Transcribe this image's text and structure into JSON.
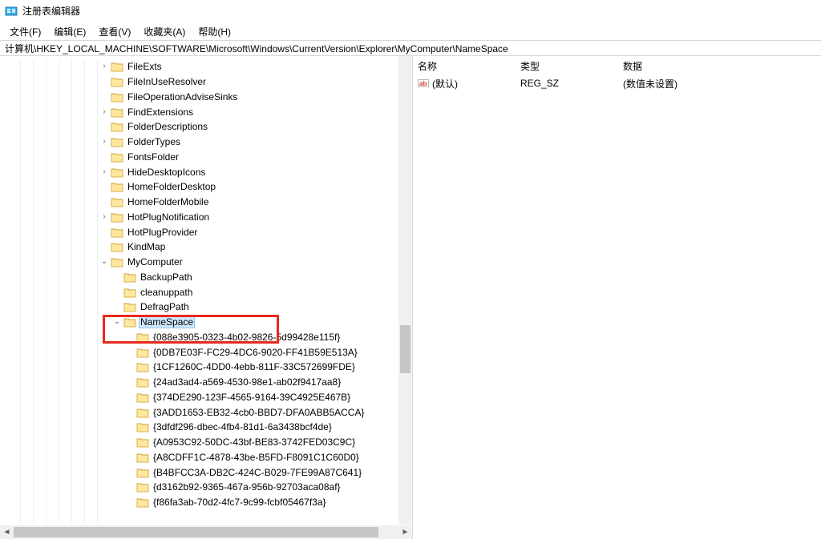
{
  "window": {
    "title": "注册表编辑器"
  },
  "menu": {
    "file": "文件(F)",
    "edit": "编辑(E)",
    "view": "查看(V)",
    "favorites": "收藏夹(A)",
    "help": "帮助(H)"
  },
  "address": "计算机\\HKEY_LOCAL_MACHINE\\SOFTWARE\\Microsoft\\Windows\\CurrentVersion\\Explorer\\MyComputer\\NameSpace",
  "tree": [
    {
      "indent": 7,
      "exp": "closed",
      "label": "FileExts"
    },
    {
      "indent": 7,
      "exp": "none",
      "label": "FileInUseResolver"
    },
    {
      "indent": 7,
      "exp": "none",
      "label": "FileOperationAdviseSinks"
    },
    {
      "indent": 7,
      "exp": "closed",
      "label": "FindExtensions"
    },
    {
      "indent": 7,
      "exp": "none",
      "label": "FolderDescriptions"
    },
    {
      "indent": 7,
      "exp": "closed",
      "label": "FolderTypes"
    },
    {
      "indent": 7,
      "exp": "none",
      "label": "FontsFolder"
    },
    {
      "indent": 7,
      "exp": "closed",
      "label": "HideDesktopIcons"
    },
    {
      "indent": 7,
      "exp": "none",
      "label": "HomeFolderDesktop"
    },
    {
      "indent": 7,
      "exp": "none",
      "label": "HomeFolderMobile"
    },
    {
      "indent": 7,
      "exp": "closed",
      "label": "HotPlugNotification"
    },
    {
      "indent": 7,
      "exp": "none",
      "label": "HotPlugProvider"
    },
    {
      "indent": 7,
      "exp": "none",
      "label": "KindMap"
    },
    {
      "indent": 7,
      "exp": "open",
      "label": "MyComputer"
    },
    {
      "indent": 8,
      "exp": "none",
      "label": "BackupPath"
    },
    {
      "indent": 8,
      "exp": "none",
      "label": "cleanuppath"
    },
    {
      "indent": 8,
      "exp": "none",
      "label": "DefragPath"
    },
    {
      "indent": 8,
      "exp": "open",
      "label": "NameSpace",
      "selected": true
    },
    {
      "indent": 9,
      "exp": "none",
      "label": "{088e3905-0323-4b02-9826-5d99428e115f}"
    },
    {
      "indent": 9,
      "exp": "none",
      "label": "{0DB7E03F-FC29-4DC6-9020-FF41B59E513A}"
    },
    {
      "indent": 9,
      "exp": "none",
      "label": "{1CF1260C-4DD0-4ebb-811F-33C572699FDE}"
    },
    {
      "indent": 9,
      "exp": "none",
      "label": "{24ad3ad4-a569-4530-98e1-ab02f9417aa8}"
    },
    {
      "indent": 9,
      "exp": "none",
      "label": "{374DE290-123F-4565-9164-39C4925E467B}"
    },
    {
      "indent": 9,
      "exp": "none",
      "label": "{3ADD1653-EB32-4cb0-BBD7-DFA0ABB5ACCA}"
    },
    {
      "indent": 9,
      "exp": "none",
      "label": "{3dfdf296-dbec-4fb4-81d1-6a3438bcf4de}"
    },
    {
      "indent": 9,
      "exp": "none",
      "label": "{A0953C92-50DC-43bf-BE83-3742FED03C9C}"
    },
    {
      "indent": 9,
      "exp": "none",
      "label": "{A8CDFF1C-4878-43be-B5FD-F8091C1C60D0}"
    },
    {
      "indent": 9,
      "exp": "none",
      "label": "{B4BFCC3A-DB2C-424C-B029-7FE99A87C641}"
    },
    {
      "indent": 9,
      "exp": "none",
      "label": "{d3162b92-9365-467a-956b-92703aca08af}"
    },
    {
      "indent": 9,
      "exp": "none",
      "label": "{f86fa3ab-70d2-4fc7-9c99-fcbf05467f3a}"
    }
  ],
  "list": {
    "columns": {
      "name": "名称",
      "type": "类型",
      "data": "数据"
    },
    "row": {
      "name": "(默认)",
      "type": "REG_SZ",
      "data": "(数值未设置)"
    }
  }
}
